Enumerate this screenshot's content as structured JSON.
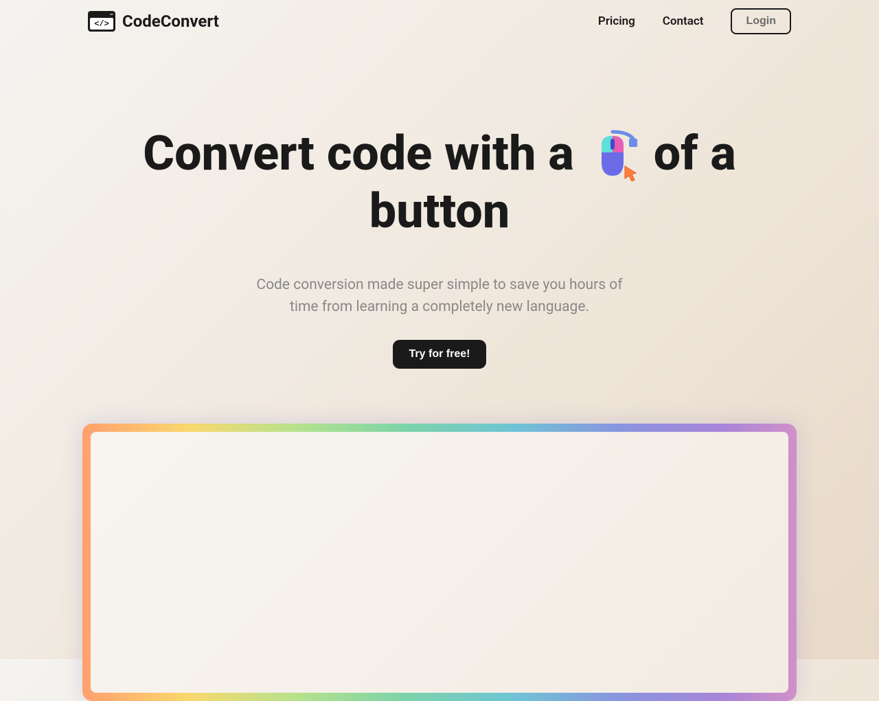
{
  "header": {
    "brand": "CodeConvert",
    "nav": {
      "pricing": "Pricing",
      "contact": "Contact",
      "login": "Login"
    }
  },
  "hero": {
    "title_part1": "Convert",
    "title_part2": "code",
    "title_part3": "with",
    "title_part4": "a",
    "title_part5": "of",
    "title_part6": "a",
    "title_part7": "button",
    "subtitle": "Code conversion made super simple to save you hours of time from learning a completely new language.",
    "cta": "Try for free!"
  }
}
